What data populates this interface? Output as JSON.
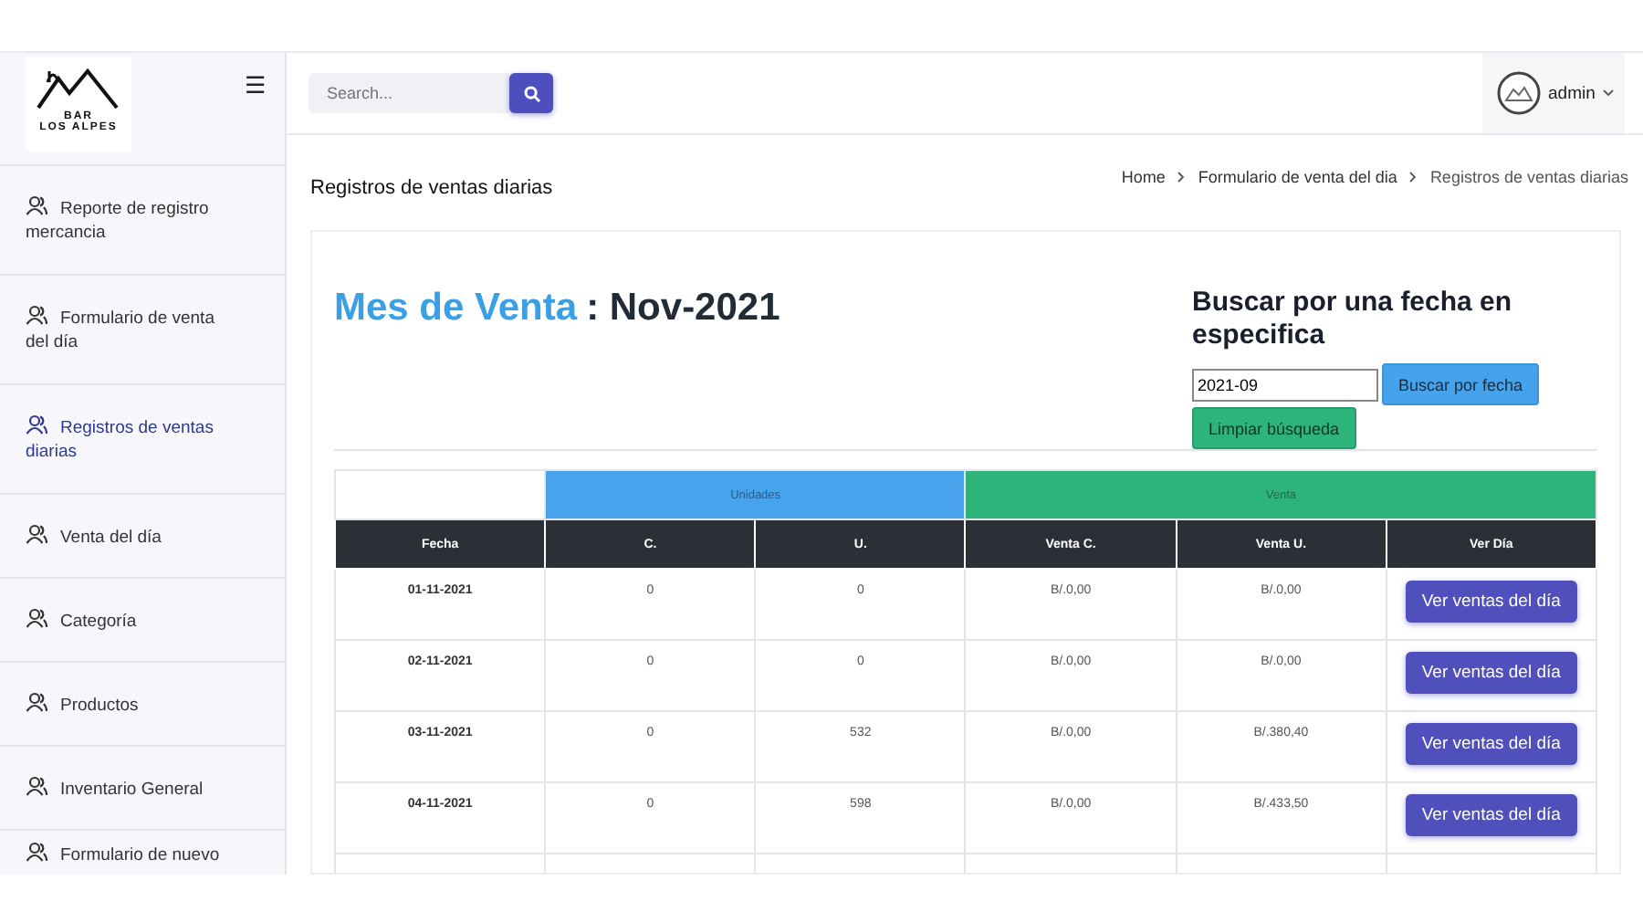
{
  "sidebar": {
    "logo": {
      "text": "BAR\nLOS ALPES"
    },
    "menu_icon": "☰",
    "items": [
      {
        "label": "Reporte de registro mercancia",
        "selected": false
      },
      {
        "label": "Formulario de venta del día",
        "selected": false
      },
      {
        "label": "Registros de ventas diarias",
        "selected": true
      },
      {
        "label": "Venta del día",
        "selected": false
      },
      {
        "label": "Categoría",
        "selected": false
      },
      {
        "label": "Productos",
        "selected": false
      },
      {
        "label": "Inventario General",
        "selected": false
      },
      {
        "label": "Formulario de nuevo",
        "selected": false
      }
    ]
  },
  "topbar": {
    "search": {
      "placeholder": "Search..."
    },
    "user": {
      "name": "admin"
    }
  },
  "page_title": "Registros de ventas diarias",
  "breadcrumb": [
    "Home",
    "Formulario de venta del dia",
    "Registros de ventas diarias"
  ],
  "month_heading": {
    "label": "Mes de Venta",
    "value": ": Nov-2021"
  },
  "date_search": {
    "title": "Buscar por una fecha en especifica",
    "value": "2021-09",
    "search_button": "Buscar por fecha",
    "clear_button": "Limpiar búsqueda"
  },
  "table": {
    "groups": [
      {
        "kind": "blank"
      },
      {
        "label": "Unidades",
        "kind": "units"
      },
      {
        "label": "Venta",
        "kind": "sales"
      }
    ],
    "columns": [
      "Fecha",
      "C.",
      "U.",
      "Venta C.",
      "Venta U.",
      "Ver Día"
    ],
    "rows": [
      {
        "date": "01-11-2021",
        "c": "0",
        "u": "0",
        "venta_c": "B/.0,00",
        "venta_u": "B/.0,00",
        "action": "Ver ventas del día"
      },
      {
        "date": "02-11-2021",
        "c": "0",
        "u": "0",
        "venta_c": "B/.0,00",
        "venta_u": "B/.0,00",
        "action": "Ver ventas del día"
      },
      {
        "date": "03-11-2021",
        "c": "0",
        "u": "532",
        "venta_c": "B/.0,00",
        "venta_u": "B/.380,40",
        "action": "Ver ventas del día"
      },
      {
        "date": "04-11-2021",
        "c": "0",
        "u": "598",
        "venta_c": "B/.0,00",
        "venta_u": "B/.433,50",
        "action": "Ver ventas del día"
      }
    ]
  }
}
